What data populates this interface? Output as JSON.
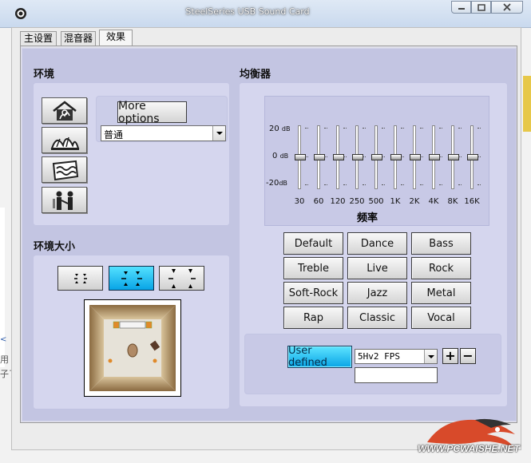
{
  "window": {
    "title": "SteelSeries USB Sound Card"
  },
  "tabs": [
    {
      "label": "主设置"
    },
    {
      "label": "混音器"
    },
    {
      "label": "效果",
      "active": true
    }
  ],
  "environment": {
    "heading": "环境",
    "more_options_label": "More options",
    "preset_value": "普通",
    "buttons": [
      "room-icon",
      "opera-house-icon",
      "underwater-icon",
      "people-icon"
    ]
  },
  "environment_size": {
    "heading": "环境大小",
    "buttons": [
      "size-small",
      "size-medium",
      "size-large"
    ],
    "selected": "size-medium"
  },
  "equalizer": {
    "heading": "均衡器",
    "db_labels": {
      "top": "20",
      "mid": "0",
      "bottom": "-20",
      "unit": "dB"
    },
    "frequency_label": "频率",
    "frequencies": [
      "30",
      "60",
      "120",
      "250",
      "500",
      "1K",
      "2K",
      "4K",
      "8K",
      "16K"
    ],
    "levels_db": [
      0,
      0,
      0,
      0,
      0,
      0,
      0,
      0,
      0,
      0
    ],
    "presets": [
      "Default",
      "Dance",
      "Bass",
      "Treble",
      "Live",
      "Rock",
      "Soft-Rock",
      "Jazz",
      "Metal",
      "Rap",
      "Classic",
      "Vocal"
    ],
    "user_defined_label": "User defined",
    "user_preset_value": "5Hv2 FPS",
    "new_preset_name": "",
    "add_symbol": "+",
    "remove_symbol": "−"
  },
  "background": {
    "left_text": [
      "用",
      "子了"
    ],
    "watermark": "WWW.PCWAISHE.NET"
  },
  "colors": {
    "panel": "#c3c5e2",
    "section": "#d5d6ee",
    "accent": "#08a4e6"
  }
}
